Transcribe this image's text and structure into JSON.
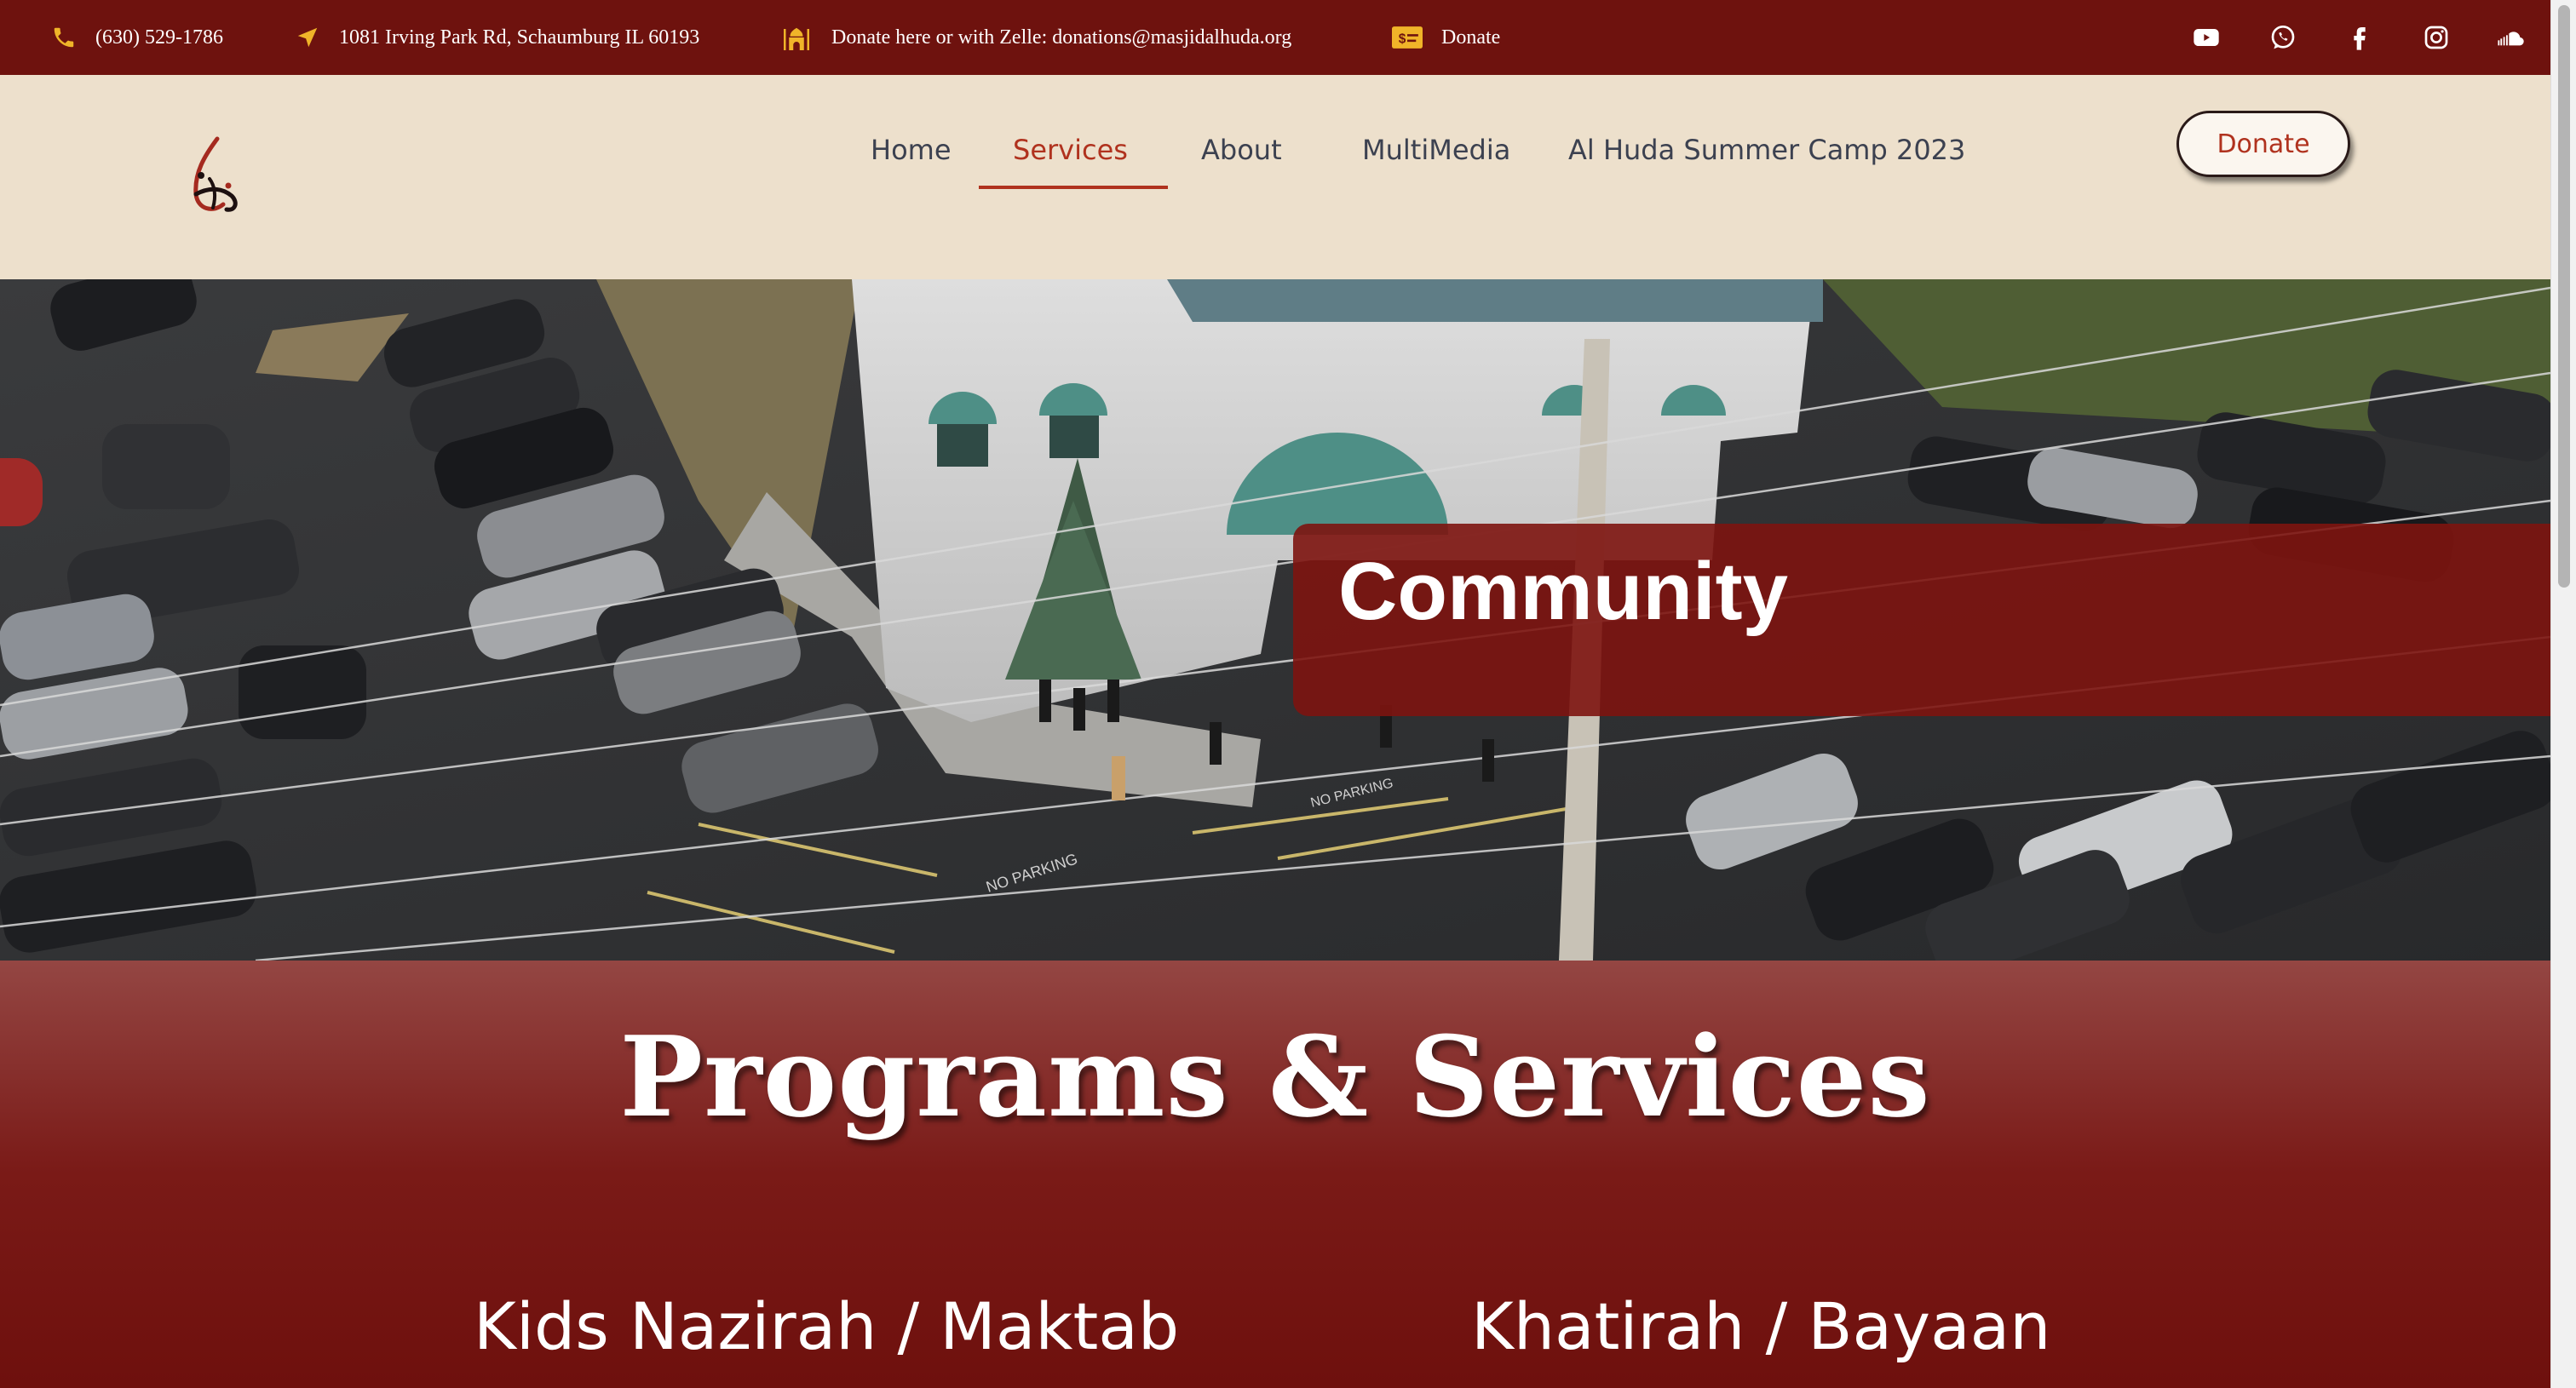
{
  "topbar": {
    "phone": "(630) 529-1786",
    "address": "1081 Irving Park Rd, Schaumburg IL 60193",
    "donate_info": "Donate here or with Zelle: donations@masjidalhuda.org",
    "donate_link": "Donate",
    "socials": [
      "youtube-icon",
      "whatsapp-icon",
      "facebook-icon",
      "instagram-icon",
      "soundcloud-icon"
    ]
  },
  "nav": {
    "items": [
      {
        "label": "Home",
        "active": false
      },
      {
        "label": "Services",
        "active": true
      },
      {
        "label": "About",
        "active": false
      },
      {
        "label": "MultiMedia",
        "active": false
      },
      {
        "label": "Al Huda Summer Camp 2023",
        "active": false
      }
    ],
    "donate_button": "Donate"
  },
  "hero": {
    "title": "Community"
  },
  "programs": {
    "title": "Programs & Services",
    "items": [
      {
        "title": "Kids Nazirah / Maktab"
      },
      {
        "title": "Khatirah / Bayaan"
      }
    ]
  },
  "colors": {
    "topbar_bg": "#6e120e",
    "header_bg": "#ede0cc",
    "accent": "#b0321e",
    "icon_gold": "#f0b429",
    "programs_bg": "#6e100d"
  }
}
